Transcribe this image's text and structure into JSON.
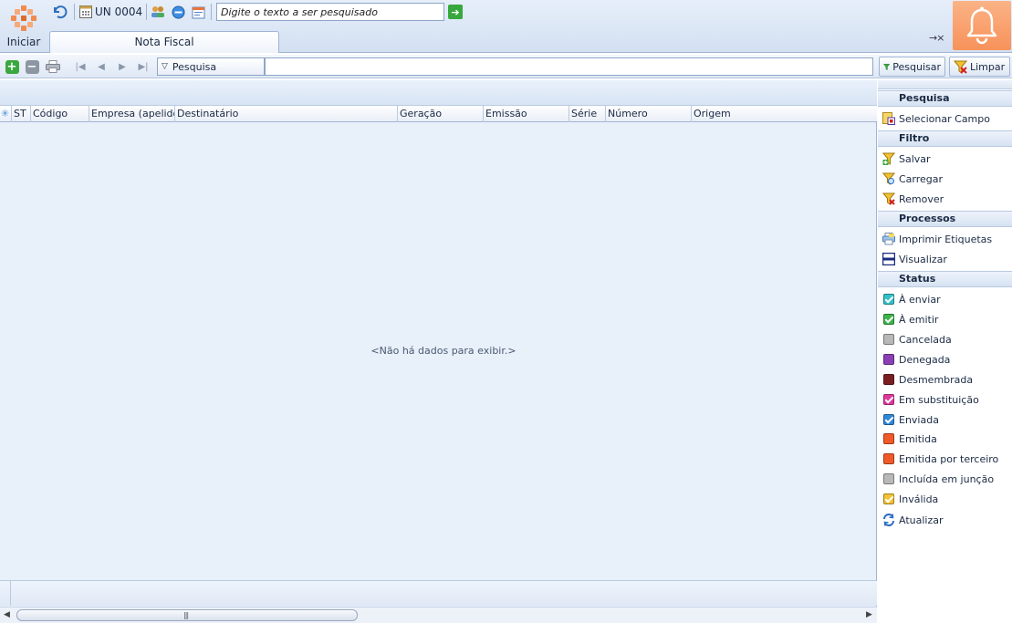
{
  "start": {
    "label": "Iniciar",
    "logo_color": "#f28a4e"
  },
  "quick_access": {
    "unit_label": "UN 0004",
    "search_value": "Digite o texto a ser pesquisado",
    "icons": [
      "undo-icon",
      "calendar-icon",
      "users-icon",
      "minus-circle-icon",
      "agenda-icon",
      "go-arrow-icon"
    ]
  },
  "tabs": [
    {
      "label": "Nota Fiscal",
      "active": true
    }
  ],
  "tab_close_label": "→×",
  "notification": {
    "icon": "bell-icon",
    "color": "#f7925a"
  },
  "toolbar": {
    "search_combo_label": "Pesquisa",
    "search_value": "",
    "search_button": "Pesquisar",
    "clear_button": "Limpar"
  },
  "grid": {
    "columns": [
      "ST",
      "Código",
      "Empresa (apelido)",
      "Destinatário",
      "Geração",
      "Emissão",
      "Série",
      "Número",
      "Origem"
    ],
    "empty_message": "<Não há dados para exibir.>"
  },
  "panel": {
    "sections": [
      {
        "title": "Pesquisa",
        "items": [
          {
            "label": "Selecionar Campo",
            "icon": "field-select-icon"
          }
        ]
      },
      {
        "title": "Filtro",
        "items": [
          {
            "label": "Salvar",
            "icon": "filter-save-icon"
          },
          {
            "label": "Carregar",
            "icon": "filter-load-icon"
          },
          {
            "label": "Remover",
            "icon": "filter-remove-icon"
          }
        ]
      },
      {
        "title": "Processos",
        "items": [
          {
            "label": "Imprimir Etiquetas",
            "icon": "print-labels-icon"
          },
          {
            "label": "Visualizar",
            "icon": "view-icon"
          }
        ]
      },
      {
        "title": "Status",
        "items": [
          {
            "label": "À enviar",
            "color": "#34c0c8",
            "checked": true
          },
          {
            "label": "À emitir",
            "color": "#3cb44a",
            "checked": true
          },
          {
            "label": "Cancelada",
            "color": "#b8b8b8",
            "checked": false
          },
          {
            "label": "Denegada",
            "color": "#8a3fb5",
            "checked": false
          },
          {
            "label": "Desmembrada",
            "color": "#7a1e22",
            "checked": false
          },
          {
            "label": "Em substituição",
            "color": "#e0389a",
            "checked": true
          },
          {
            "label": "Enviada",
            "color": "#2f88d8",
            "checked": true
          },
          {
            "label": "Emitida",
            "color": "#f05a28",
            "checked": false
          },
          {
            "label": "Emitida por terceiro",
            "color": "#f05a28",
            "checked": false
          },
          {
            "label": "Incluída em junção",
            "color": "#b8b8b8",
            "checked": false
          },
          {
            "label": "Inválida",
            "color": "#f2c232",
            "checked": true
          }
        ]
      }
    ],
    "refresh_label": "Atualizar"
  }
}
